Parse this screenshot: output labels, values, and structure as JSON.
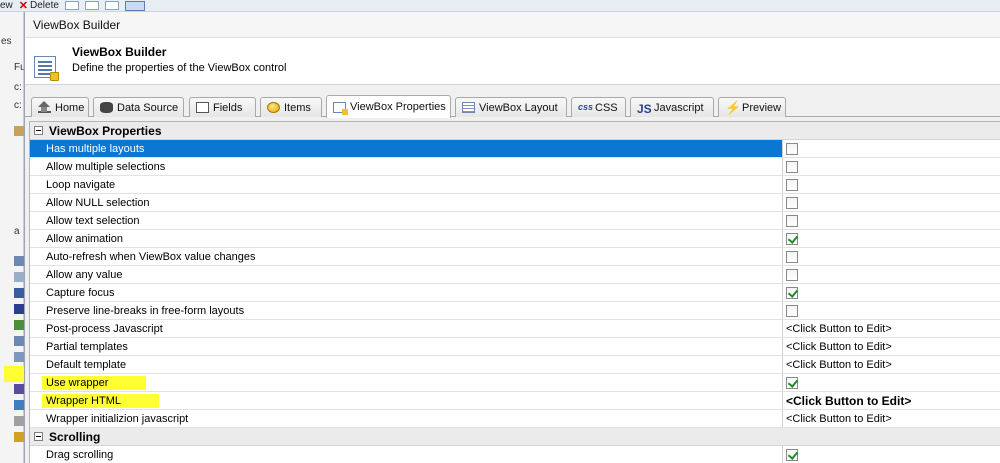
{
  "background": {
    "toolbar": {
      "view_label": "ew",
      "delete_label": "Delete"
    },
    "left_fragments": [
      "es",
      "Fu",
      "c:",
      "c:",
      "a"
    ]
  },
  "dialog": {
    "title": "ViewBox Builder",
    "header": {
      "title": "ViewBox Builder",
      "subtitle": "Define the properties of the ViewBox control",
      "icon": "viewbox-properties-icon"
    },
    "tabs": [
      {
        "label": "Home",
        "icon": "home-icon",
        "active": false
      },
      {
        "label": "Data Source",
        "icon": "database-icon",
        "active": false
      },
      {
        "label": "Fields",
        "icon": "fields-icon",
        "active": false
      },
      {
        "label": "Items",
        "icon": "items-icon",
        "active": false
      },
      {
        "label": "ViewBox Properties",
        "icon": "viewbox-properties-icon",
        "active": true
      },
      {
        "label": "ViewBox Layout",
        "icon": "layout-icon",
        "active": false
      },
      {
        "label": "CSS",
        "icon": "css-icon",
        "active": false
      },
      {
        "label": "Javascript",
        "icon": "javascript-icon",
        "active": false
      },
      {
        "label": "Preview",
        "icon": "lightning-icon",
        "active": false
      }
    ],
    "tab_icon_text": {
      "css": "css",
      "js": "JS",
      "preview": "⚡"
    },
    "grid": {
      "categories": [
        {
          "name": "ViewBox Properties",
          "rows": [
            {
              "label": "Has multiple layouts",
              "type": "check",
              "checked": false,
              "selected": true
            },
            {
              "label": "Allow multiple selections",
              "type": "check",
              "checked": false
            },
            {
              "label": "Loop navigate",
              "type": "check",
              "checked": false
            },
            {
              "label": "Allow NULL selection",
              "type": "check",
              "checked": false
            },
            {
              "label": "Allow text selection",
              "type": "check",
              "checked": false
            },
            {
              "label": "Allow animation",
              "type": "check",
              "checked": true
            },
            {
              "label": "Auto-refresh when ViewBox value changes",
              "type": "check",
              "checked": false
            },
            {
              "label": "Allow any value",
              "type": "check",
              "checked": false
            },
            {
              "label": "Capture focus",
              "type": "check",
              "checked": true
            },
            {
              "label": "Preserve line-breaks in free-form layouts",
              "type": "check",
              "checked": false
            },
            {
              "label": "Post-process Javascript",
              "type": "text",
              "value": "<Click Button to Edit>"
            },
            {
              "label": "Partial templates",
              "type": "text",
              "value": "<Click Button to Edit>"
            },
            {
              "label": "Default template",
              "type": "text",
              "value": "<Click Button to Edit>"
            },
            {
              "label": "Use wrapper",
              "type": "check",
              "checked": true,
              "highlight": true
            },
            {
              "label": "Wrapper HTML",
              "type": "text",
              "value": "<Click Button to Edit>",
              "bold": true,
              "highlight": true
            },
            {
              "label": "Wrapper initializion javascript",
              "type": "text",
              "value": "<Click Button to Edit>"
            }
          ]
        },
        {
          "name": "Scrolling",
          "rows": [
            {
              "label": "Drag scrolling",
              "type": "check",
              "checked": true
            }
          ]
        }
      ]
    }
  },
  "colors": {
    "selection": "#0a77d5",
    "highlighter": "#ffff33",
    "check": "#1f8a2a"
  }
}
